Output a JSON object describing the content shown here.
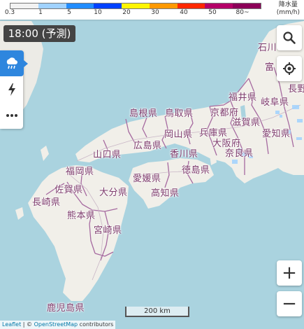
{
  "legend": {
    "colors": [
      "#f2f2f2",
      "#a0d2ff",
      "#218cff",
      "#0041ff",
      "#fff500",
      "#ff9900",
      "#ff2800",
      "#b40068",
      "#8b0058"
    ],
    "ticks": [
      "0.3",
      "1",
      "5",
      "10",
      "20",
      "30",
      "40",
      "50",
      "80~"
    ],
    "unit_line1": "降水量",
    "unit_line2": "(mm/h)"
  },
  "time_label": "18:00 (予測)",
  "side_panel": {
    "items": [
      "rain-cloud-icon",
      "lightning-icon",
      "more-icon"
    ]
  },
  "controls": {
    "search_icon": "search-icon",
    "locate_icon": "locate-icon",
    "zoom_in": "+",
    "zoom_out": "−"
  },
  "prefectures": [
    {
      "name": "石川"
    },
    {
      "name": "富"
    },
    {
      "name": "長野"
    },
    {
      "name": "福井県"
    },
    {
      "name": "岐阜県"
    },
    {
      "name": "島根県"
    },
    {
      "name": "鳥取県"
    },
    {
      "name": "京都府"
    },
    {
      "name": "滋賀県"
    },
    {
      "name": "愛知県"
    },
    {
      "name": "岡山県"
    },
    {
      "name": "兵庫県"
    },
    {
      "name": "大阪府"
    },
    {
      "name": "奈良県"
    },
    {
      "name": "山口県"
    },
    {
      "name": "広島県"
    },
    {
      "name": "香川県"
    },
    {
      "name": "福岡県"
    },
    {
      "name": "愛媛県"
    },
    {
      "name": "徳島県"
    },
    {
      "name": "佐賀県"
    },
    {
      "name": "大分県"
    },
    {
      "name": "高知県"
    },
    {
      "name": "長崎県"
    },
    {
      "name": "熊本県"
    },
    {
      "name": "宮崎県"
    },
    {
      "name": "鹿児島県"
    }
  ],
  "scale": "200 km",
  "attribution": {
    "leaflet": "Leaflet",
    "sep": " | © ",
    "osm": "OpenStreetMap",
    "contrib": " contributors"
  }
}
